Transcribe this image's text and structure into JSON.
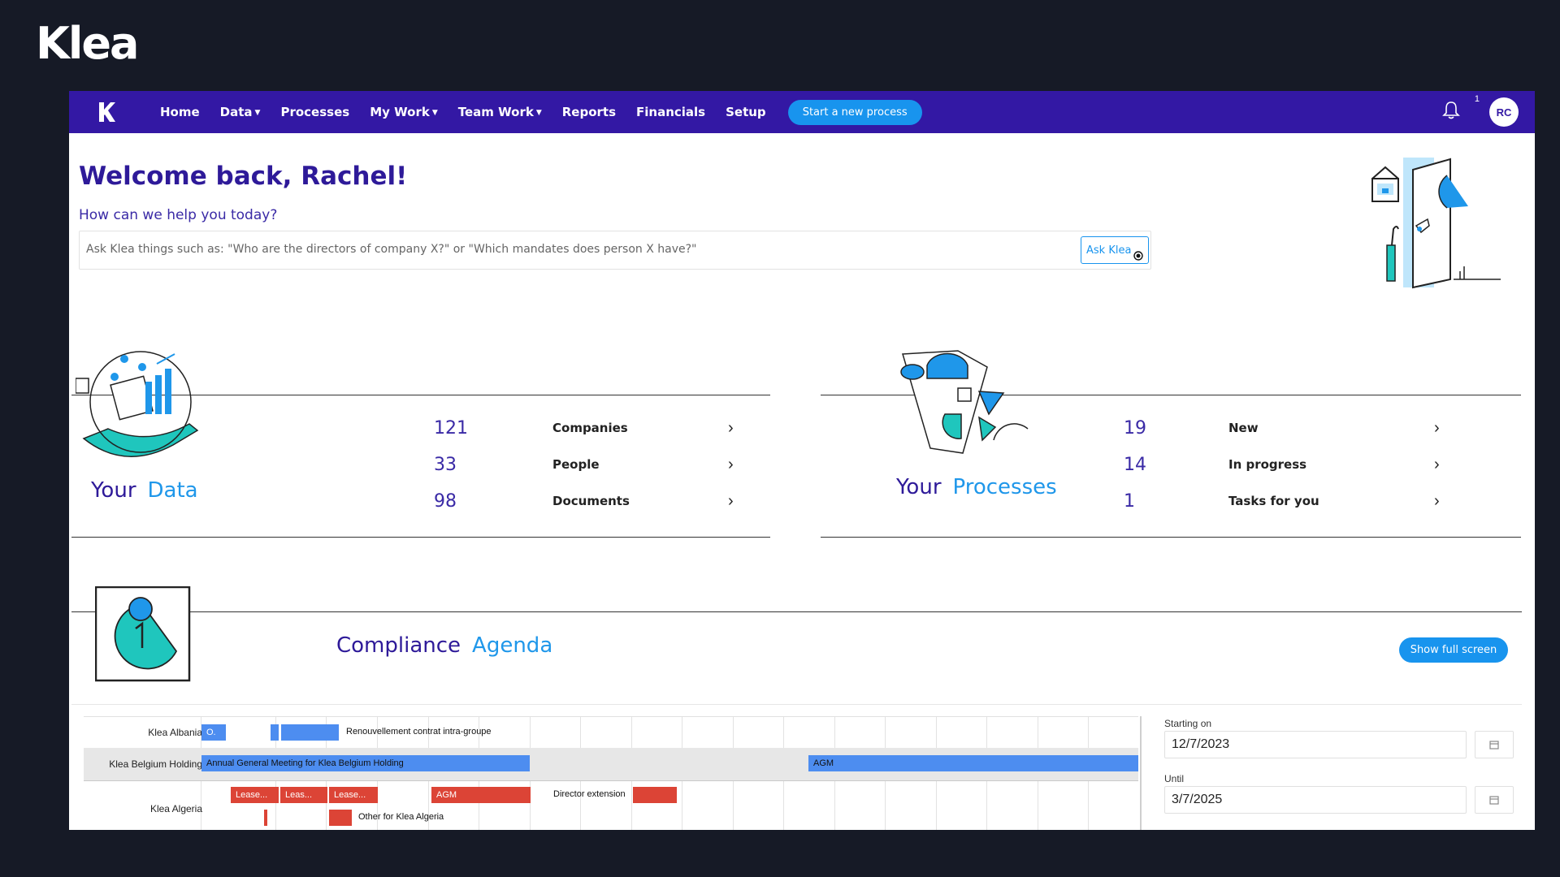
{
  "brand": {
    "name": "Klea"
  },
  "nav": {
    "items": [
      {
        "label": "Home",
        "dropdown": false
      },
      {
        "label": "Data",
        "dropdown": true
      },
      {
        "label": "Processes",
        "dropdown": false
      },
      {
        "label": "My Work",
        "dropdown": true
      },
      {
        "label": "Team Work",
        "dropdown": true
      },
      {
        "label": "Reports",
        "dropdown": false
      },
      {
        "label": "Financials",
        "dropdown": false
      },
      {
        "label": "Setup",
        "dropdown": false
      }
    ],
    "start_button": "Start a new process",
    "notification_count": "1",
    "avatar_initials": "RC"
  },
  "welcome": {
    "title": "Welcome back, Rachel!",
    "subtitle": "How can we help you today?",
    "ask_placeholder": "Ask Klea things such as: \"Who are the directors of company X?\" or \"Which mandates does person X have?\"",
    "ask_button": "Ask Klea"
  },
  "your_data": {
    "label_1": "Your",
    "label_2": "Data",
    "stats": [
      {
        "value": "121",
        "label": "Companies"
      },
      {
        "value": "33",
        "label": "People"
      },
      {
        "value": "98",
        "label": "Documents"
      }
    ]
  },
  "your_processes": {
    "label_1": "Your",
    "label_2": "Processes",
    "stats": [
      {
        "value": "19",
        "label": "New"
      },
      {
        "value": "14",
        "label": "In progress"
      },
      {
        "value": "1",
        "label": "Tasks for you"
      }
    ]
  },
  "compliance": {
    "label_1": "Compliance",
    "label_2": "Agenda",
    "show_full_screen": "Show full screen",
    "rows": [
      {
        "entity": "Klea Albania",
        "bars": [
          {
            "label": "O."
          },
          {
            "label": ""
          },
          {
            "label": ""
          }
        ],
        "texts": [
          "Renouvellement contrat intra-groupe"
        ]
      },
      {
        "entity": "Klea Belgium Holding",
        "bars": [
          {
            "label": "Annual General Meeting for Klea Belgium Holding"
          },
          {
            "label": "AGM"
          }
        ]
      },
      {
        "entity": "Klea Algeria",
        "bars": [
          {
            "label": "Lease..."
          },
          {
            "label": "Leas..."
          },
          {
            "label": "Lease..."
          },
          {
            "label": "AGM"
          },
          {
            "label": ""
          },
          {
            "label": ""
          },
          {
            "label": ""
          }
        ],
        "texts": [
          "Director extension",
          "Other for Klea Algeria"
        ]
      }
    ],
    "starting_on_label": "Starting on",
    "starting_on_value": "12/7/2023",
    "until_label": "Until",
    "until_value": "3/7/2025"
  },
  "colors": {
    "navbar": "#3318a4",
    "accent_blue": "#1894ee",
    "title_purple": "#2e1a99",
    "gantt_blue": "#4d8df0",
    "gantt_red": "#dc4436",
    "background": "#161a26"
  },
  "icons": [
    "klea-logo-icon",
    "bell-icon",
    "chevron-right-icon",
    "calendar-icon",
    "cursor-icon"
  ]
}
